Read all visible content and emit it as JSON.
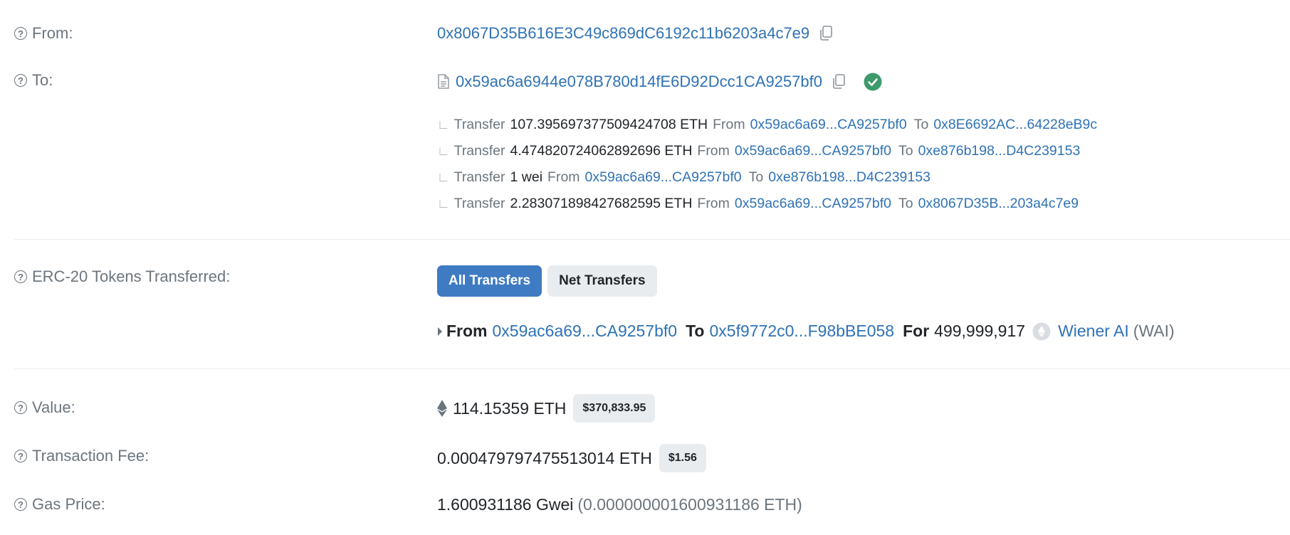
{
  "from": {
    "label": "From:",
    "address": "0x8067D35B616E3C49c869dC6192c11b6203a4c7e9"
  },
  "to": {
    "label": "To:",
    "address": "0x59ac6a6944e078B780d14fE6D92Dcc1CA9257bf0"
  },
  "internal_transfers": [
    {
      "word": "Transfer",
      "amount": "107.395697377509424708 ETH",
      "from_word": "From",
      "from": "0x59ac6a69...CA9257bf0",
      "to_word": "To",
      "to": "0x8E6692AC...64228eB9c"
    },
    {
      "word": "Transfer",
      "amount": "4.474820724062892696 ETH",
      "from_word": "From",
      "from": "0x59ac6a69...CA9257bf0",
      "to_word": "To",
      "to": "0xe876b198...D4C239153"
    },
    {
      "word": "Transfer",
      "amount": "1 wei",
      "from_word": "From",
      "from": "0x59ac6a69...CA9257bf0",
      "to_word": "To",
      "to": "0xe876b198...D4C239153"
    },
    {
      "word": "Transfer",
      "amount": "2.283071898427682595 ETH",
      "from_word": "From",
      "from": "0x59ac6a69...CA9257bf0",
      "to_word": "To",
      "to": "0x8067D35B...203a4c7e9"
    }
  ],
  "erc20": {
    "label": "ERC-20 Tokens Transferred:",
    "tab_all": "All Transfers",
    "tab_net": "Net Transfers",
    "row": {
      "from_word": "From",
      "from": "0x59ac6a69...CA9257bf0",
      "to_word": "To",
      "to": "0x5f9772c0...F98bBE058",
      "for_word": "For",
      "amount": "499,999,917",
      "token_name": "Wiener AI",
      "token_symbol": "(WAI)"
    }
  },
  "value": {
    "label": "Value:",
    "amount": "114.15359 ETH",
    "usd": "$370,833.95"
  },
  "fee": {
    "label": "Transaction Fee:",
    "amount": "0.000479797475513014 ETH",
    "usd": "$1.56"
  },
  "gas": {
    "label": "Gas Price:",
    "gwei": "1.600931186 Gwei",
    "eth": "(0.000000001600931186 ETH)"
  },
  "icons": {
    "help": "help-circle-icon",
    "copy": "copy-icon",
    "verified": "check-circle-icon",
    "contract": "document-icon",
    "eth": "ethereum-icon",
    "token": "token-logo-icon",
    "caret": "caret-right-icon"
  },
  "colors": {
    "link": "#2f72b5",
    "primary_button": "#3e7bc2",
    "verified": "#3d9a6b",
    "muted": "#6c757d"
  }
}
